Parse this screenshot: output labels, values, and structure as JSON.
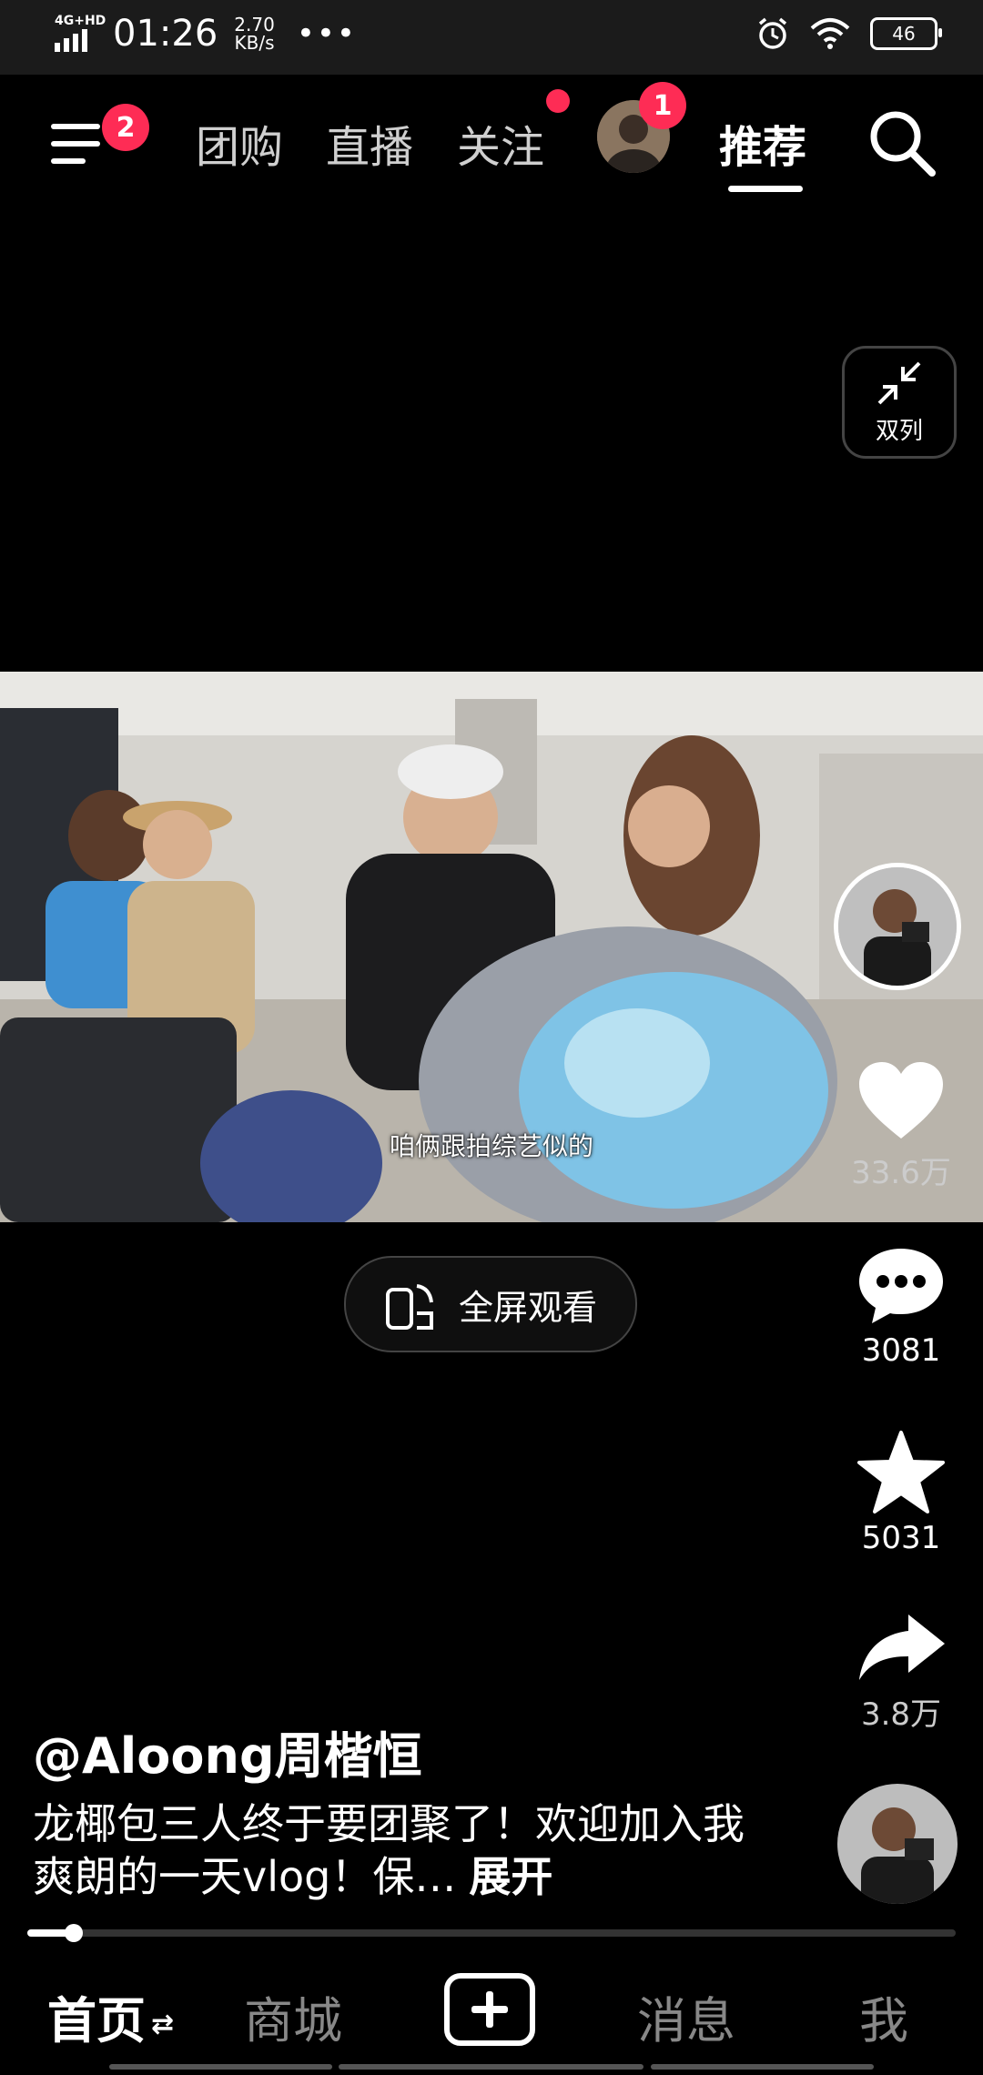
{
  "status_bar": {
    "network": "4G+HD",
    "time": "01:26",
    "speed_value": "2.70",
    "speed_unit": "KB/s",
    "more": "•••",
    "battery": "46"
  },
  "top_nav": {
    "menu_badge": "2",
    "tabs": [
      "团购",
      "直播",
      "关注",
      "推荐"
    ],
    "follow_dot": true,
    "avatar_badge": "1",
    "active_tab": "推荐"
  },
  "dual_column_label": "双列",
  "video": {
    "subtitle": "咱俩跟拍综艺似的"
  },
  "fullscreen_label": "全屏观看",
  "actions": {
    "likes": "33.6万",
    "comments": "3081",
    "favorites": "5031",
    "shares": "3.8万"
  },
  "post": {
    "author": "@Aloong周楷恒",
    "description": "龙椰包三人终于要团聚了！欢迎加入我爽朗的一天vlog！保…",
    "expand_label": "展开"
  },
  "playback_progress": 0.05,
  "bottom_nav": {
    "home": "首页",
    "home_switch": "⇄",
    "mall": "商城",
    "messages": "消息",
    "me": "我"
  },
  "colors": {
    "accent": "#fe2c55",
    "background": "#000000"
  }
}
